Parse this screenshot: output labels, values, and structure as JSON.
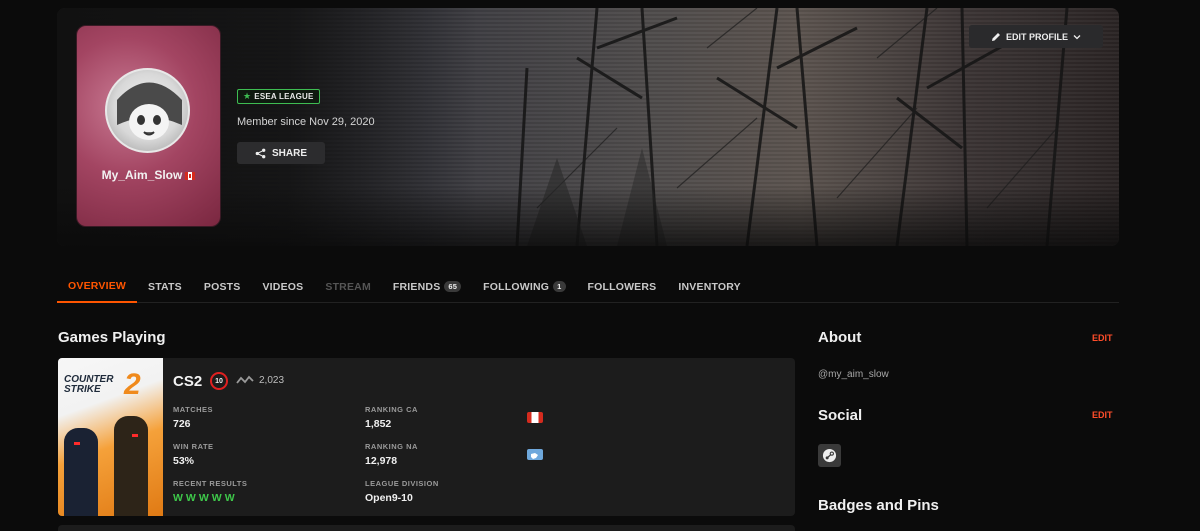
{
  "profile": {
    "username": "My_Aim_Slow",
    "member_since": "Member since Nov 29, 2020",
    "league_badge": "ESEA LEAGUE",
    "share_label": "SHARE",
    "edit_profile_label": "EDIT PROFILE"
  },
  "tabs": [
    {
      "label": "OVERVIEW",
      "active": true
    },
    {
      "label": "STATS"
    },
    {
      "label": "POSTS"
    },
    {
      "label": "VIDEOS"
    },
    {
      "label": "STREAM",
      "disabled": true
    },
    {
      "label": "FRIENDS",
      "count": "65"
    },
    {
      "label": "FOLLOWING",
      "count": "1"
    },
    {
      "label": "FOLLOWERS"
    },
    {
      "label": "INVENTORY"
    }
  ],
  "games": {
    "title": "Games Playing",
    "game": {
      "name": "CS2",
      "art_line1": "COUNTER",
      "art_line2": "STRIKE",
      "art_number": "2",
      "level": "10",
      "elo": "2,023",
      "matches_label": "MATCHES",
      "matches": "726",
      "win_rate_label": "WIN RATE",
      "win_rate": "53%",
      "recent_label": "RECENT RESULTS",
      "recent": [
        "W",
        "W",
        "W",
        "W",
        "W"
      ],
      "ranking_ca_label": "RANKING CA",
      "ranking_ca": "1,852",
      "ranking_na_label": "RANKING NA",
      "ranking_na": "12,978",
      "league_div_label": "LEAGUE DIVISION",
      "league_div": "Open9-10"
    }
  },
  "sidebar": {
    "about_title": "About",
    "about_edit": "EDIT",
    "handle": "@my_aim_slow",
    "social_title": "Social",
    "social_edit": "EDIT",
    "badges_title": "Badges and Pins"
  },
  "colors": {
    "accent": "#ff5500",
    "win": "#3ec84a",
    "esea_green": "#3ebd52"
  },
  "icons": [
    "share-icon",
    "pencil-icon",
    "chevron-down-icon",
    "star-icon",
    "elo-icon",
    "steam-icon"
  ]
}
